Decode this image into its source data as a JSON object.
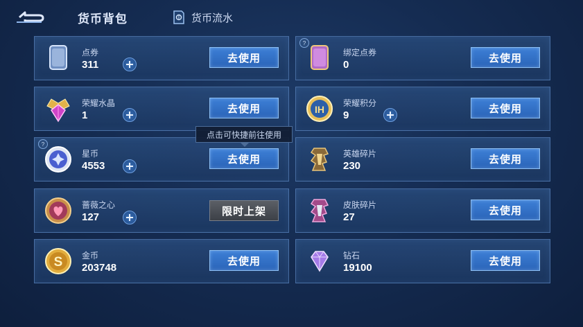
{
  "header": {
    "title": "货币背包",
    "flow_label": "货币流水"
  },
  "tooltip": "点击可快捷前往使用",
  "currencies": [
    {
      "name": "点券",
      "amount": "311",
      "action": "去使用"
    },
    {
      "name": "绑定点券",
      "amount": "0",
      "action": "去使用"
    },
    {
      "name": "荣耀水晶",
      "amount": "1",
      "action": "去使用"
    },
    {
      "name": "荣耀积分",
      "amount": "9",
      "action": "去使用"
    },
    {
      "name": "星币",
      "amount": "4553",
      "action": "去使用"
    },
    {
      "name": "英雄碎片",
      "amount": "230",
      "action": "去使用"
    },
    {
      "name": "蔷薇之心",
      "amount": "127",
      "action": "限时上架"
    },
    {
      "name": "皮肤碎片",
      "amount": "27",
      "action": "去使用"
    },
    {
      "name": "金币",
      "amount": "203748",
      "action": "去使用"
    },
    {
      "name": "钻石",
      "amount": "19100",
      "action": "去使用"
    }
  ],
  "icons": {
    "back": "back-arrow-icon",
    "flow": "ledger-icon",
    "coupon": "coupon-card-icon",
    "bound_coupon": "bound-coupon-card-icon",
    "crystal": "glory-crystal-icon",
    "glory_points": "glory-points-icon",
    "star_coin": "star-coin-icon",
    "hero_shard": "hero-shard-icon",
    "rose_heart": "rose-heart-icon",
    "skin_shard": "skin-shard-icon",
    "gold": "gold-coin-icon",
    "diamond": "diamond-icon"
  },
  "colors": {
    "button_blue": "#3d7fd6",
    "button_gray": "#5b5f66",
    "card_bg": "#284a7a",
    "accent_gold": "#e8c05a"
  }
}
